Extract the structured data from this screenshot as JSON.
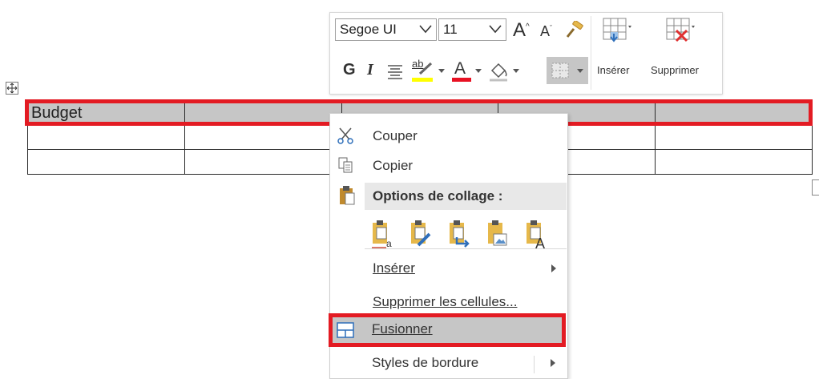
{
  "toolbar": {
    "font_name": "Segoe UI",
    "font_size": "11",
    "bold": "G",
    "italic": "I",
    "insert_label": "Insérer",
    "delete_label": "Supprimer",
    "grow_font_glyph": "A",
    "shrink_font_glyph": "A",
    "font_color_glyph": "A",
    "highlight_glyph": "ab",
    "highlight_color": "#ffff00",
    "font_color": "#e81123"
  },
  "table": {
    "rows": [
      [
        "Budget",
        "",
        "",
        "",
        ""
      ],
      [
        "",
        "",
        "",
        "",
        ""
      ],
      [
        "",
        "",
        "",
        "",
        ""
      ]
    ],
    "header_fill": "#c6c6c6"
  },
  "context_menu": {
    "cut": "Couper",
    "copy": "Copier",
    "paste_options": "Options de collage :",
    "insert": "Insérer",
    "delete_cells": "Supprimer les cellules...",
    "merge": "Fusionner",
    "border_styles": "Styles de bordure",
    "paste_icons": [
      "keep-source-formatting-icon",
      "merge-formatting-icon",
      "use-destination-styles-icon",
      "paste-as-picture-icon",
      "keep-text-only-icon"
    ]
  },
  "highlight_color": "#e31b23"
}
